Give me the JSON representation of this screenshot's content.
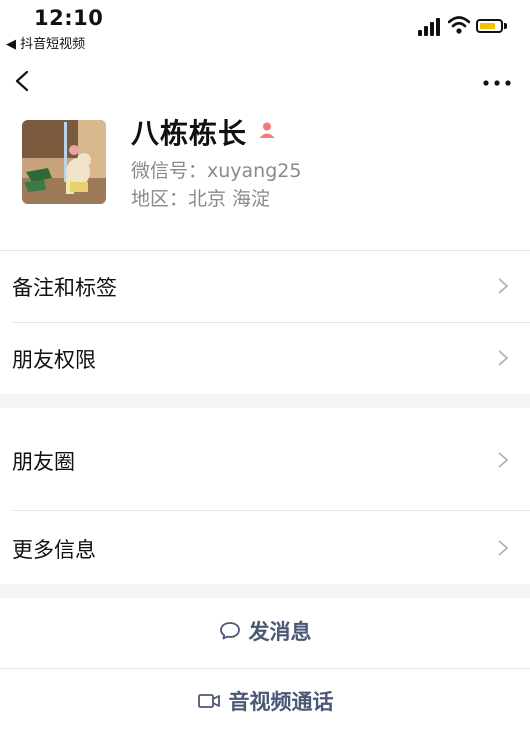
{
  "status_bar": {
    "time": "12:10",
    "back_to_app": "◀ 抖音短视频",
    "battery_color": "#f2c200"
  },
  "nav": {
    "back_icon": "chevron-left-icon",
    "more_icon": "more-dots-icon"
  },
  "profile": {
    "name": "八栋栋长",
    "wechat_id": "微信号：xuyang25",
    "region": "地区：北京 海淀",
    "gender_icon": "person-icon",
    "gender_icon_color": "#f07c7c"
  },
  "menu": {
    "remarks_tags": "备注和标签",
    "friend_permissions": "朋友权限",
    "moments": "朋友圈",
    "more_info": "更多信息"
  },
  "actions": {
    "send_message": "发消息",
    "av_call": "音视频通话",
    "accent_color": "#4b5775"
  }
}
